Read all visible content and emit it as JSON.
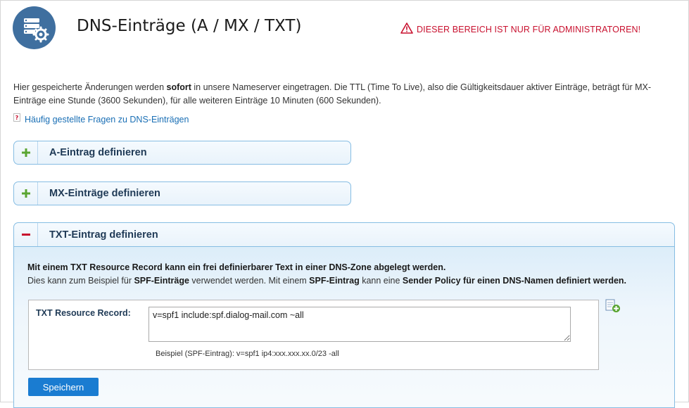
{
  "header": {
    "icon": "server-settings-icon",
    "title": "DNS-Einträge (A / MX / TXT)",
    "admin_warning": "DIESER BEREICH IST NUR FÜR ADMINISTRATOREN!",
    "warning_icon": "warning-triangle-icon",
    "warning_color": "#c8102e"
  },
  "intro": {
    "part1": "Hier gespeicherte Änderungen werden ",
    "bold": "sofort",
    "part2": " in unsere Nameserver eingetragen. Die TTL (Time To Live), also die Gültigkeitsdauer aktiver Einträge, beträgt für MX-Einträge eine Stunde (3600 Sekunden), für alle weiteren Einträge 10 Minuten (600 Sekunden).",
    "faq_link": "Häufig gestellte Fragen zu DNS-Einträgen",
    "faq_icon": "help-icon"
  },
  "accordion": {
    "a_record": {
      "label": "A-Eintrag definieren",
      "state": "collapsed",
      "icon": "plus-icon"
    },
    "mx_record": {
      "label": "MX-Einträge definieren",
      "state": "collapsed",
      "icon": "plus-icon"
    },
    "txt_record": {
      "label": "TXT-Eintrag definieren",
      "state": "expanded",
      "icon": "minus-icon",
      "desc_line1": "Mit einem TXT Resource Record kann ein frei definierbarer Text in einer DNS-Zone abgelegt werden.",
      "desc_line2_a": "Dies kann zum Beispiel für ",
      "desc_line2_b": "SPF-Einträge",
      "desc_line2_c": " verwendet werden. Mit einem ",
      "desc_line2_d": "SPF-Eintrag",
      "desc_line2_e": " kann eine ",
      "desc_line2_f": "Sender Policy für einen DNS-Namen definiert werden.",
      "field_label": "TXT Resource Record:",
      "field_value": "v=spf1 include:spf.dialog-mail.com ~all",
      "example": "Beispiel (SPF-Eintrag): v=spf1 ip4:xxx.xxx.xx.0/23 -all",
      "add_icon": "add-row-icon",
      "save_label": "Speichern"
    }
  },
  "colors": {
    "accent": "#1a7cd1",
    "plus_green": "#5aa532",
    "minus_red": "#c8102e",
    "panel_border": "#86bde3",
    "heading_dark": "#1f3a56"
  }
}
